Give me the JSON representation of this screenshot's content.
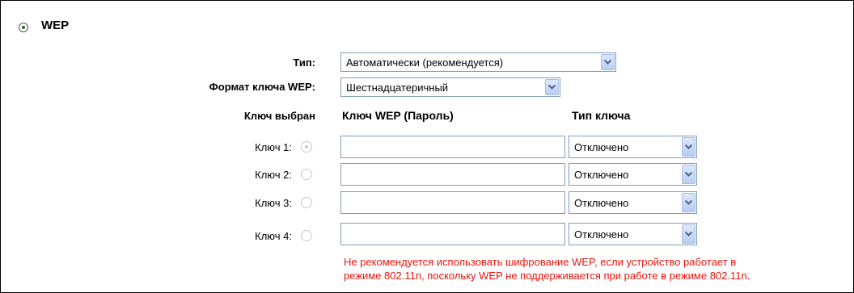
{
  "section": {
    "title": "WEP"
  },
  "fields": {
    "type_label": "Тип:",
    "type_value": "Автоматически (рекомендуется)",
    "format_label": "Формат ключа WEP:",
    "format_value": "Шестнадцатеричный"
  },
  "table": {
    "headers": {
      "selected": "Ключ выбран",
      "key": "Ключ WEP (Пароль)",
      "key_type": "Тип ключа"
    },
    "rows": [
      {
        "label": "Ключ 1:",
        "selected": true,
        "value": "",
        "key_type": "Отключено"
      },
      {
        "label": "Ключ 2:",
        "selected": false,
        "value": "",
        "key_type": "Отключено"
      },
      {
        "label": "Ключ 3:",
        "selected": false,
        "value": "",
        "key_type": "Отключено"
      },
      {
        "label": "Ключ 4:",
        "selected": false,
        "value": "",
        "key_type": "Отключено"
      }
    ]
  },
  "warning": {
    "line1": "Не рекомендуется использовать шифрование WEP, если устройство работает в",
    "line2": "режиме 802.11n, поскольку WEP не поддерживается при работе в режиме 802.11n."
  },
  "colors": {
    "warning": "#e8160c",
    "section_radio": "#1a6d2a",
    "input_border": "#7f9db9"
  }
}
